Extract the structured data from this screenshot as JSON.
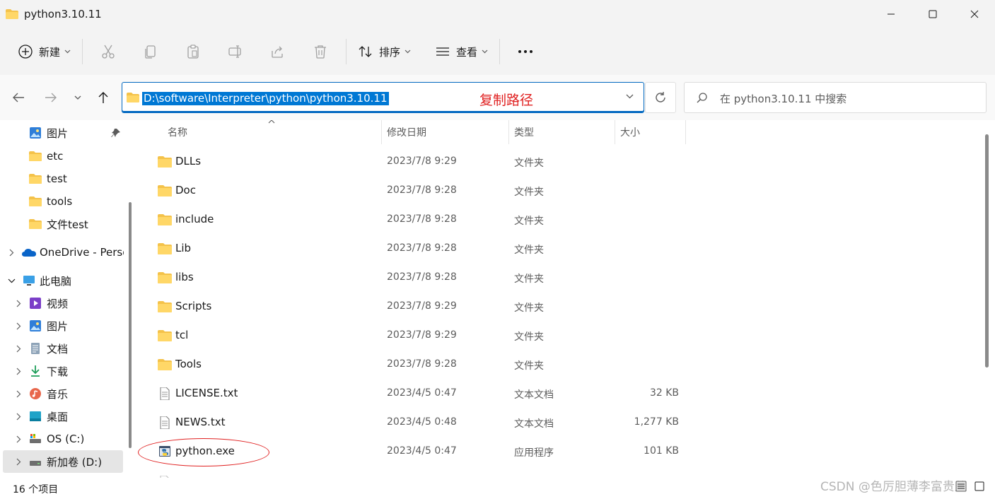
{
  "window": {
    "title": "python3.10.11"
  },
  "toolbar": {
    "new_label": "新建",
    "sort_label": "排序",
    "view_label": "查看"
  },
  "address": {
    "path": "D:\\software\\Interpreter\\python\\python3.10.11",
    "annotation": "复制路径"
  },
  "search": {
    "placeholder": "在 python3.10.11 中搜索"
  },
  "sidebar": {
    "items": [
      {
        "label": "图片",
        "icon": "pictures-icon"
      },
      {
        "label": "etc",
        "icon": "folder-icon"
      },
      {
        "label": "test",
        "icon": "folder-icon"
      },
      {
        "label": "tools",
        "icon": "folder-icon"
      },
      {
        "label": "文件test",
        "icon": "folder-icon"
      },
      {
        "label": "OneDrive - Perso",
        "icon": "onedrive-icon"
      },
      {
        "label": "此电脑",
        "icon": "pc-icon"
      },
      {
        "label": "视频",
        "icon": "videos-icon"
      },
      {
        "label": "图片",
        "icon": "pictures-icon"
      },
      {
        "label": "文档",
        "icon": "documents-icon"
      },
      {
        "label": "下载",
        "icon": "downloads-icon"
      },
      {
        "label": "音乐",
        "icon": "music-icon"
      },
      {
        "label": "桌面",
        "icon": "desktop-icon"
      },
      {
        "label": "OS (C:)",
        "icon": "drive-c-icon"
      },
      {
        "label": "新加卷 (D:)",
        "icon": "drive-d-icon"
      }
    ]
  },
  "columns": {
    "name": "名称",
    "date": "修改日期",
    "type": "类型",
    "size": "大小"
  },
  "files": [
    {
      "name": "DLLs",
      "date": "2023/7/8 9:29",
      "type": "文件夹",
      "size": "",
      "icon": "folder-icon"
    },
    {
      "name": "Doc",
      "date": "2023/7/8 9:28",
      "type": "文件夹",
      "size": "",
      "icon": "folder-icon"
    },
    {
      "name": "include",
      "date": "2023/7/8 9:28",
      "type": "文件夹",
      "size": "",
      "icon": "folder-icon"
    },
    {
      "name": "Lib",
      "date": "2023/7/8 9:28",
      "type": "文件夹",
      "size": "",
      "icon": "folder-icon"
    },
    {
      "name": "libs",
      "date": "2023/7/8 9:28",
      "type": "文件夹",
      "size": "",
      "icon": "folder-icon"
    },
    {
      "name": "Scripts",
      "date": "2023/7/8 9:29",
      "type": "文件夹",
      "size": "",
      "icon": "folder-icon"
    },
    {
      "name": "tcl",
      "date": "2023/7/8 9:29",
      "type": "文件夹",
      "size": "",
      "icon": "folder-icon"
    },
    {
      "name": "Tools",
      "date": "2023/7/8 9:28",
      "type": "文件夹",
      "size": "",
      "icon": "folder-icon"
    },
    {
      "name": "LICENSE.txt",
      "date": "2023/4/5 0:47",
      "type": "文本文档",
      "size": "32 KB",
      "icon": "text-file-icon"
    },
    {
      "name": "NEWS.txt",
      "date": "2023/4/5 0:48",
      "type": "文本文档",
      "size": "1,277 KB",
      "icon": "text-file-icon"
    },
    {
      "name": "python.exe",
      "date": "2023/4/5 0:47",
      "type": "应用程序",
      "size": "101 KB",
      "icon": "python-exe-icon"
    }
  ],
  "status": {
    "count": "16 个项目"
  },
  "watermark": "CSDN @色厉胆薄李富贵儿"
}
